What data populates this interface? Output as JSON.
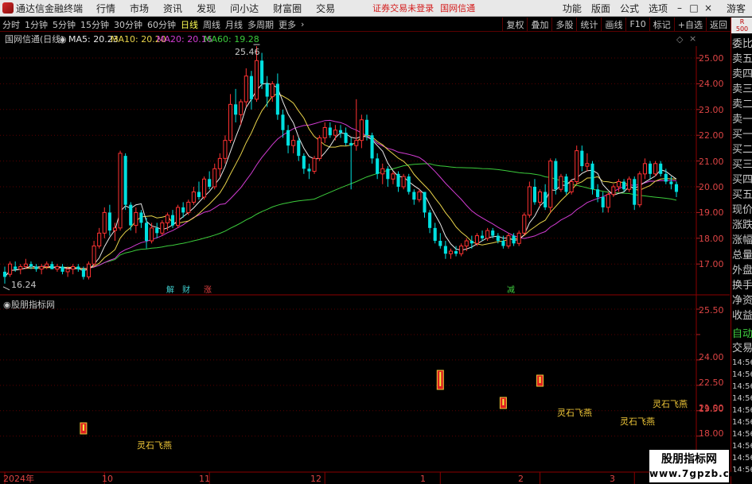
{
  "title_bar": {
    "app_name": "通达信金融终端",
    "menu": [
      "行情",
      "市场",
      "资讯",
      "发现",
      "问小达",
      "财富圈",
      "交易"
    ],
    "warning": "证券交易未登录",
    "stock": "国网信通",
    "right_menu": [
      "功能",
      "版面",
      "公式",
      "选项"
    ],
    "guest": "游客",
    "colors": {
      "bar": "#e8e8e8",
      "warning": "#d41c1c"
    }
  },
  "toolbar": {
    "periods": [
      "分时",
      "1分钟",
      "5分钟",
      "15分钟",
      "30分钟",
      "60分钟",
      "日线",
      "周线",
      "月线",
      "多周期",
      "更多"
    ],
    "active_period": "日线",
    "buttons": [
      "复权",
      "叠加",
      "多股",
      "统计",
      "画线",
      "F10",
      "标记",
      "+自选",
      "返回"
    ]
  },
  "main_chart": {
    "stock_label": "国网信通(日线)",
    "ma_labels": [
      {
        "text": "MA5: 20.23",
        "color": "#e8e8e8"
      },
      {
        "text": "MA10: 20.20",
        "color": "#e8d34a"
      },
      {
        "text": "MA20: 20.16",
        "color": "#d23cd2"
      },
      {
        "text": "MA60: 19.28",
        "color": "#3ccc3c"
      }
    ],
    "high_label": "25.46",
    "low_label": "16.24",
    "y_ticks": [
      "25.00",
      "24.00",
      "23.00",
      "22.00",
      "21.00",
      "20.00",
      "19.00",
      "18.00",
      "17.00"
    ],
    "events": [
      {
        "text": "解",
        "color": "#40d0d0"
      },
      {
        "text": "财",
        "color": "#40d0d0"
      },
      {
        "text": "涨",
        "color": "#e04040"
      },
      {
        "text": "减",
        "color": "#40d040"
      }
    ]
  },
  "indicator": {
    "title": "股朋指标网",
    "y_ticks": [
      "25.50",
      "24.00",
      "22.50",
      "21.00",
      "19.50",
      "18.00"
    ],
    "signal_label": "灵石飞燕",
    "signal_count": 4
  },
  "x_axis": [
    "2024年",
    "10",
    "11",
    "12",
    "1",
    "2",
    "3"
  ],
  "side_panel": {
    "badge": [
      "R",
      "500"
    ],
    "items": [
      "委比",
      "卖五",
      "卖四",
      "卖三",
      "卖二",
      "卖一",
      "买一",
      "买二",
      "买三",
      "买四",
      "买五",
      "现价",
      "涨跌",
      "涨幅",
      "总量",
      "外盘",
      "换手",
      "净资",
      "收益"
    ],
    "auto_trade": [
      "自动",
      "交易"
    ],
    "times": [
      "14:56",
      "14:56",
      "14:56",
      "14:56",
      "14:56",
      "14:56",
      "14:56",
      "14:56",
      "14:56",
      "14:56"
    ]
  },
  "watermark": {
    "line1": "股朋指标网",
    "line2": "www.7gpzb.com"
  },
  "chart_data": {
    "type": "candlestick",
    "price_range": [
      16.24,
      25.46
    ],
    "ohlc": [
      {
        "o": 16.7,
        "h": 16.9,
        "l": 16.24,
        "c": 16.5
      },
      {
        "o": 16.6,
        "h": 17.1,
        "l": 16.5,
        "c": 17.0
      },
      {
        "o": 16.9,
        "h": 17.1,
        "l": 16.7,
        "c": 16.8
      },
      {
        "o": 16.8,
        "h": 17.0,
        "l": 16.6,
        "c": 16.9
      },
      {
        "o": 16.9,
        "h": 17.2,
        "l": 16.8,
        "c": 17.0
      },
      {
        "o": 17.0,
        "h": 17.1,
        "l": 16.8,
        "c": 16.9
      },
      {
        "o": 16.9,
        "h": 17.0,
        "l": 16.7,
        "c": 16.8
      },
      {
        "o": 16.8,
        "h": 17.0,
        "l": 16.6,
        "c": 16.9
      },
      {
        "o": 16.9,
        "h": 17.1,
        "l": 16.8,
        "c": 17.0
      },
      {
        "o": 17.0,
        "h": 17.1,
        "l": 16.8,
        "c": 16.8
      },
      {
        "o": 16.8,
        "h": 17.0,
        "l": 16.7,
        "c": 16.9
      },
      {
        "o": 16.9,
        "h": 17.0,
        "l": 16.6,
        "c": 16.7
      },
      {
        "o": 16.7,
        "h": 16.9,
        "l": 16.5,
        "c": 16.8
      },
      {
        "o": 16.8,
        "h": 17.0,
        "l": 16.6,
        "c": 16.9
      },
      {
        "o": 16.9,
        "h": 17.0,
        "l": 16.7,
        "c": 16.8
      },
      {
        "o": 16.8,
        "h": 16.9,
        "l": 16.4,
        "c": 16.5
      },
      {
        "o": 16.5,
        "h": 17.1,
        "l": 16.4,
        "c": 17.0
      },
      {
        "o": 17.0,
        "h": 17.9,
        "l": 16.9,
        "c": 17.7
      },
      {
        "o": 17.7,
        "h": 18.4,
        "l": 17.6,
        "c": 18.2
      },
      {
        "o": 18.2,
        "h": 19.2,
        "l": 18.0,
        "c": 19.0
      },
      {
        "o": 19.0,
        "h": 19.3,
        "l": 18.1,
        "c": 18.3
      },
      {
        "o": 18.3,
        "h": 18.6,
        "l": 17.9,
        "c": 18.4
      },
      {
        "o": 18.4,
        "h": 21.4,
        "l": 18.3,
        "c": 21.3
      },
      {
        "o": 21.2,
        "h": 21.3,
        "l": 19.1,
        "c": 19.3
      },
      {
        "o": 19.3,
        "h": 19.4,
        "l": 18.3,
        "c": 18.5
      },
      {
        "o": 18.5,
        "h": 19.2,
        "l": 18.2,
        "c": 19.0
      },
      {
        "o": 19.0,
        "h": 19.1,
        "l": 18.4,
        "c": 18.6
      },
      {
        "o": 18.6,
        "h": 18.8,
        "l": 17.6,
        "c": 17.9
      },
      {
        "o": 17.9,
        "h": 18.6,
        "l": 17.8,
        "c": 18.4
      },
      {
        "o": 18.4,
        "h": 18.6,
        "l": 18.0,
        "c": 18.2
      },
      {
        "o": 18.2,
        "h": 18.7,
        "l": 18.1,
        "c": 18.6
      },
      {
        "o": 18.6,
        "h": 19.0,
        "l": 18.3,
        "c": 18.9
      },
      {
        "o": 18.9,
        "h": 19.1,
        "l": 18.4,
        "c": 18.5
      },
      {
        "o": 18.5,
        "h": 19.3,
        "l": 18.4,
        "c": 19.2
      },
      {
        "o": 19.2,
        "h": 19.4,
        "l": 18.8,
        "c": 19.0
      },
      {
        "o": 19.0,
        "h": 19.5,
        "l": 18.9,
        "c": 19.4
      },
      {
        "o": 19.4,
        "h": 20.0,
        "l": 19.3,
        "c": 19.8
      },
      {
        "o": 19.8,
        "h": 20.2,
        "l": 19.5,
        "c": 19.6
      },
      {
        "o": 19.6,
        "h": 20.4,
        "l": 19.5,
        "c": 20.3
      },
      {
        "o": 20.3,
        "h": 20.6,
        "l": 19.9,
        "c": 20.0
      },
      {
        "o": 20.0,
        "h": 20.9,
        "l": 19.9,
        "c": 20.7
      },
      {
        "o": 20.7,
        "h": 21.3,
        "l": 20.4,
        "c": 21.1
      },
      {
        "o": 21.1,
        "h": 22.0,
        "l": 20.9,
        "c": 21.8
      },
      {
        "o": 21.8,
        "h": 23.6,
        "l": 21.7,
        "c": 23.2
      },
      {
        "o": 23.2,
        "h": 23.8,
        "l": 22.5,
        "c": 22.8
      },
      {
        "o": 22.8,
        "h": 23.4,
        "l": 22.4,
        "c": 23.3
      },
      {
        "o": 23.3,
        "h": 24.6,
        "l": 23.1,
        "c": 24.3
      },
      {
        "o": 24.3,
        "h": 24.5,
        "l": 23.0,
        "c": 23.4
      },
      {
        "o": 23.4,
        "h": 25.46,
        "l": 23.3,
        "c": 24.9
      },
      {
        "o": 24.9,
        "h": 25.2,
        "l": 23.8,
        "c": 24.0
      },
      {
        "o": 24.0,
        "h": 24.3,
        "l": 23.1,
        "c": 23.5
      },
      {
        "o": 23.5,
        "h": 24.1,
        "l": 23.3,
        "c": 24.0
      },
      {
        "o": 24.0,
        "h": 24.4,
        "l": 22.6,
        "c": 22.8
      },
      {
        "o": 22.8,
        "h": 23.0,
        "l": 21.9,
        "c": 22.2
      },
      {
        "o": 22.2,
        "h": 22.4,
        "l": 21.3,
        "c": 21.6
      },
      {
        "o": 21.6,
        "h": 22.0,
        "l": 21.3,
        "c": 21.8
      },
      {
        "o": 21.8,
        "h": 21.9,
        "l": 21.0,
        "c": 21.2
      },
      {
        "o": 21.2,
        "h": 21.3,
        "l": 20.5,
        "c": 20.7
      },
      {
        "o": 20.7,
        "h": 20.9,
        "l": 20.3,
        "c": 20.6
      },
      {
        "o": 20.6,
        "h": 21.2,
        "l": 20.5,
        "c": 21.1
      },
      {
        "o": 21.1,
        "h": 22.0,
        "l": 21.0,
        "c": 21.9
      },
      {
        "o": 21.9,
        "h": 22.5,
        "l": 21.7,
        "c": 22.3
      },
      {
        "o": 22.3,
        "h": 22.5,
        "l": 21.9,
        "c": 22.0
      },
      {
        "o": 22.0,
        "h": 22.4,
        "l": 21.8,
        "c": 22.2
      },
      {
        "o": 22.2,
        "h": 22.4,
        "l": 21.9,
        "c": 22.1
      },
      {
        "o": 22.1,
        "h": 22.3,
        "l": 21.6,
        "c": 21.7
      },
      {
        "o": 21.7,
        "h": 21.9,
        "l": 19.9,
        "c": 21.6
      },
      {
        "o": 21.6,
        "h": 23.4,
        "l": 21.4,
        "c": 21.8
      },
      {
        "o": 21.8,
        "h": 22.8,
        "l": 21.5,
        "c": 22.6
      },
      {
        "o": 22.6,
        "h": 22.8,
        "l": 21.8,
        "c": 22.0
      },
      {
        "o": 22.0,
        "h": 22.1,
        "l": 20.9,
        "c": 21.1
      },
      {
        "o": 21.1,
        "h": 21.3,
        "l": 20.3,
        "c": 20.5
      },
      {
        "o": 20.5,
        "h": 20.9,
        "l": 20.1,
        "c": 20.7
      },
      {
        "o": 20.7,
        "h": 20.8,
        "l": 20.0,
        "c": 20.3
      },
      {
        "o": 20.3,
        "h": 20.6,
        "l": 20.1,
        "c": 20.5
      },
      {
        "o": 20.5,
        "h": 20.6,
        "l": 19.8,
        "c": 20.0
      },
      {
        "o": 20.0,
        "h": 20.5,
        "l": 19.9,
        "c": 20.4
      },
      {
        "o": 20.4,
        "h": 20.5,
        "l": 19.7,
        "c": 19.8
      },
      {
        "o": 19.8,
        "h": 19.9,
        "l": 19.3,
        "c": 19.5
      },
      {
        "o": 19.5,
        "h": 19.9,
        "l": 19.4,
        "c": 19.8
      },
      {
        "o": 19.8,
        "h": 19.8,
        "l": 18.8,
        "c": 19.0
      },
      {
        "o": 19.0,
        "h": 19.1,
        "l": 18.2,
        "c": 18.4
      },
      {
        "o": 18.4,
        "h": 18.6,
        "l": 17.8,
        "c": 17.9
      },
      {
        "o": 17.9,
        "h": 18.2,
        "l": 17.6,
        "c": 17.7
      },
      {
        "o": 17.7,
        "h": 17.9,
        "l": 17.2,
        "c": 17.4
      },
      {
        "o": 17.4,
        "h": 17.6,
        "l": 17.2,
        "c": 17.5
      },
      {
        "o": 17.5,
        "h": 17.7,
        "l": 17.3,
        "c": 17.4
      },
      {
        "o": 17.4,
        "h": 17.8,
        "l": 17.3,
        "c": 17.7
      },
      {
        "o": 17.7,
        "h": 18.0,
        "l": 17.5,
        "c": 17.9
      },
      {
        "o": 17.9,
        "h": 18.1,
        "l": 17.6,
        "c": 17.8
      },
      {
        "o": 17.8,
        "h": 18.2,
        "l": 17.7,
        "c": 18.1
      },
      {
        "o": 18.1,
        "h": 18.3,
        "l": 17.9,
        "c": 18.0
      },
      {
        "o": 18.0,
        "h": 18.4,
        "l": 17.9,
        "c": 18.3
      },
      {
        "o": 18.3,
        "h": 18.4,
        "l": 18.0,
        "c": 18.1
      },
      {
        "o": 18.1,
        "h": 18.2,
        "l": 17.8,
        "c": 17.9
      },
      {
        "o": 17.9,
        "h": 18.1,
        "l": 17.6,
        "c": 17.7
      },
      {
        "o": 17.7,
        "h": 18.2,
        "l": 17.6,
        "c": 18.1
      },
      {
        "o": 18.1,
        "h": 18.2,
        "l": 17.7,
        "c": 17.8
      },
      {
        "o": 17.8,
        "h": 18.3,
        "l": 17.7,
        "c": 18.2
      },
      {
        "o": 18.2,
        "h": 19.0,
        "l": 18.1,
        "c": 18.9
      },
      {
        "o": 18.9,
        "h": 20.2,
        "l": 18.8,
        "c": 20.0
      },
      {
        "o": 20.0,
        "h": 20.3,
        "l": 19.3,
        "c": 19.4
      },
      {
        "o": 19.4,
        "h": 19.9,
        "l": 19.2,
        "c": 19.8
      },
      {
        "o": 19.8,
        "h": 20.1,
        "l": 19.1,
        "c": 19.2
      },
      {
        "o": 19.2,
        "h": 21.1,
        "l": 19.0,
        "c": 21.0
      },
      {
        "o": 21.0,
        "h": 21.1,
        "l": 19.7,
        "c": 19.9
      },
      {
        "o": 19.9,
        "h": 20.5,
        "l": 19.8,
        "c": 20.4
      },
      {
        "o": 20.4,
        "h": 20.5,
        "l": 19.7,
        "c": 19.8
      },
      {
        "o": 19.8,
        "h": 20.3,
        "l": 19.7,
        "c": 20.2
      },
      {
        "o": 20.2,
        "h": 21.6,
        "l": 20.1,
        "c": 21.4
      },
      {
        "o": 21.4,
        "h": 21.6,
        "l": 20.6,
        "c": 20.8
      },
      {
        "o": 20.8,
        "h": 21.3,
        "l": 20.6,
        "c": 20.9
      },
      {
        "o": 20.9,
        "h": 21.0,
        "l": 19.7,
        "c": 19.9
      },
      {
        "o": 19.9,
        "h": 20.1,
        "l": 19.4,
        "c": 19.6
      },
      {
        "o": 19.6,
        "h": 19.8,
        "l": 19.0,
        "c": 19.2
      },
      {
        "o": 19.2,
        "h": 19.8,
        "l": 19.0,
        "c": 19.7
      },
      {
        "o": 19.7,
        "h": 20.1,
        "l": 19.6,
        "c": 20.0
      },
      {
        "o": 20.0,
        "h": 20.3,
        "l": 19.8,
        "c": 20.2
      },
      {
        "o": 20.2,
        "h": 20.3,
        "l": 19.8,
        "c": 19.9
      },
      {
        "o": 19.9,
        "h": 20.4,
        "l": 19.8,
        "c": 20.3
      },
      {
        "o": 20.3,
        "h": 20.4,
        "l": 19.1,
        "c": 19.3
      },
      {
        "o": 19.3,
        "h": 20.6,
        "l": 19.2,
        "c": 20.5
      },
      {
        "o": 20.5,
        "h": 21.1,
        "l": 20.3,
        "c": 20.9
      },
      {
        "o": 20.9,
        "h": 21.0,
        "l": 20.3,
        "c": 20.5
      },
      {
        "o": 20.5,
        "h": 21.0,
        "l": 20.4,
        "c": 20.9
      },
      {
        "o": 20.9,
        "h": 21.0,
        "l": 20.4,
        "c": 20.5
      },
      {
        "o": 20.5,
        "h": 20.7,
        "l": 20.1,
        "c": 20.2
      },
      {
        "o": 20.2,
        "h": 20.4,
        "l": 19.9,
        "c": 20.1
      },
      {
        "o": 20.1,
        "h": 20.2,
        "l": 19.6,
        "c": 19.8
      }
    ],
    "ma_visible_values": {
      "MA5": 20.23,
      "MA10": 20.2,
      "MA20": 20.16,
      "MA60": 19.28
    },
    "up_color": "#ff3232",
    "down_color": "#00e0e0",
    "signal_bars": [
      15,
      83,
      95,
      102
    ]
  }
}
